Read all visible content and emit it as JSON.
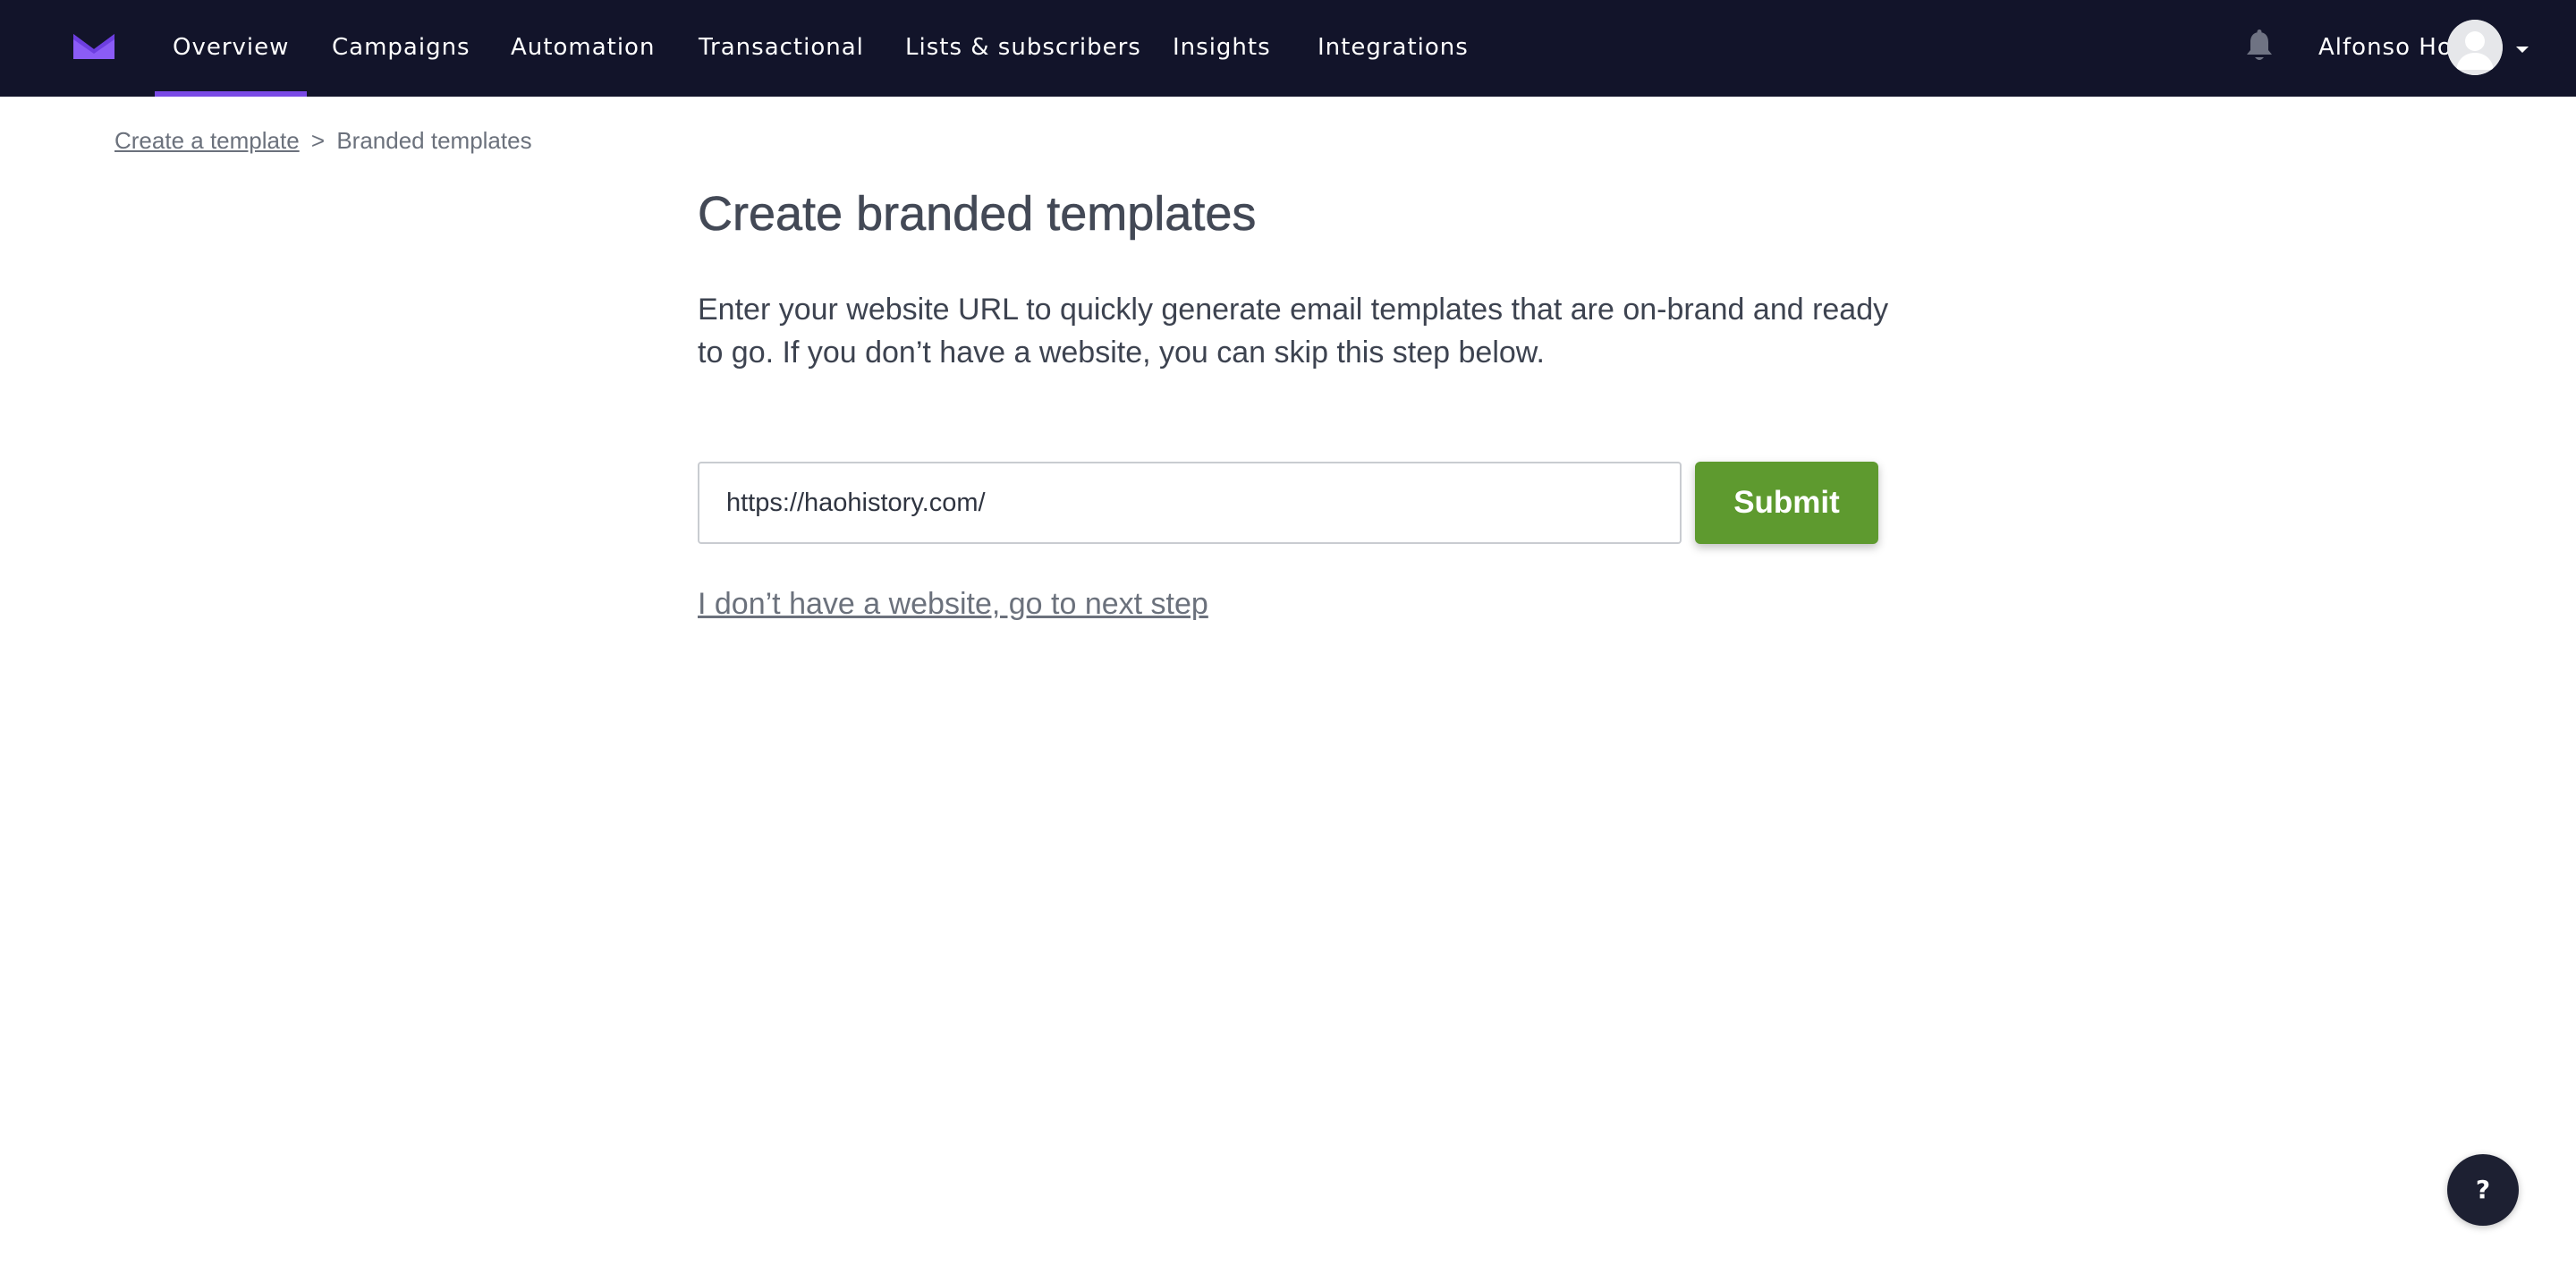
{
  "brand": {
    "logo_icon": "envelope-logo-icon",
    "accent_color": "#7a4ae6",
    "nav_background": "#12142a"
  },
  "nav": {
    "items": [
      {
        "label": "Overview",
        "active": true
      },
      {
        "label": "Campaigns",
        "active": false
      },
      {
        "label": "Automation",
        "active": false
      },
      {
        "label": "Transactional",
        "active": false
      },
      {
        "label": "Lists & subscribers",
        "active": false
      },
      {
        "label": "Insights",
        "active": false
      },
      {
        "label": "Integrations",
        "active": false
      }
    ],
    "notification_icon": "bell-icon",
    "user": {
      "name": "Alfonso Ho",
      "avatar_icon": "avatar-icon",
      "menu_icon": "caret-down-icon"
    }
  },
  "breadcrumb": {
    "parent_label": "Create a template",
    "separator": ">",
    "current_label": "Branded templates"
  },
  "main": {
    "title": "Create branded templates",
    "description": "Enter your website URL to quickly generate email templates that are on-brand and ready to go. If you don’t have a website, you can skip this step below.",
    "url_input": {
      "value": "https://haohistory.com/"
    },
    "submit_label": "Submit",
    "submit_color": "#5e9a2f",
    "skip_link": "I don’t have a website, go to next step"
  },
  "help": {
    "label": "?",
    "icon": "help-icon"
  }
}
